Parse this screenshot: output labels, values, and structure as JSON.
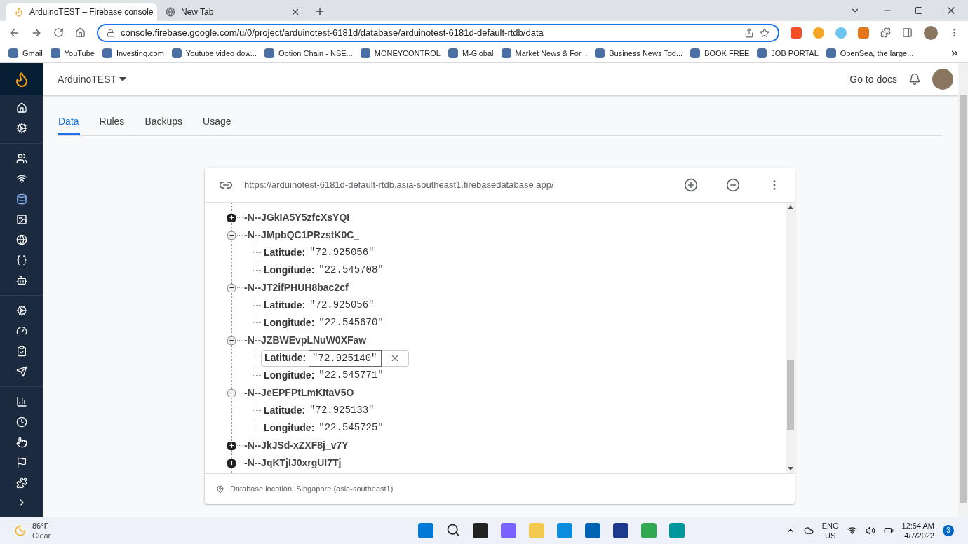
{
  "browser": {
    "tabs": [
      {
        "title": "ArduinoTEST – Firebase console",
        "selected": true
      },
      {
        "title": "New Tab",
        "selected": false
      }
    ],
    "address": "console.firebase.google.com/u/0/project/arduinotest-6181d/database/arduinotest-6181d-default-rtdb/data",
    "bookmarks": [
      "Gmail",
      "YouTube",
      "Investing.com",
      "Youtube video dow...",
      "Option Chain - NSE...",
      "MONEYCONTROL",
      "M-Global",
      "Market News & For...",
      "Business News Tod...",
      "BOOK FREE",
      "JOB PORTAL",
      "OpenSea, the large..."
    ]
  },
  "header": {
    "project": "ArduinoTEST",
    "docs_link": "Go to docs"
  },
  "tabs": [
    {
      "label": "Data",
      "selected": true
    },
    {
      "label": "Rules",
      "selected": false
    },
    {
      "label": "Backups",
      "selected": false
    },
    {
      "label": "Usage",
      "selected": false
    }
  ],
  "database": {
    "url": "https://arduinotest-6181d-default-rtdb.asia-southeast1.firebasedatabase.app/",
    "nodes": [
      {
        "key": "-N--JGkIA5Y5zfcXsYQI",
        "expanded": false
      },
      {
        "key": "-N--JMpbQC1PRzstK0C_",
        "expanded": true,
        "children": [
          {
            "key": "Latitude:",
            "value": "\"72.925056\"",
            "editing": false
          },
          {
            "key": "Longitude:",
            "value": "\"22.545708\"",
            "editing": false
          }
        ]
      },
      {
        "key": "-N--JT2ifPHUH8bac2cf",
        "expanded": true,
        "children": [
          {
            "key": "Latitude:",
            "value": "\"72.925056\"",
            "editing": false
          },
          {
            "key": "Longitude:",
            "value": "\"22.545670\"",
            "editing": false
          }
        ]
      },
      {
        "key": "-N--JZBWEvpLNuW0XFaw",
        "expanded": true,
        "children": [
          {
            "key": "Latitude:",
            "value": "\"72.925140\"",
            "editing": true
          },
          {
            "key": "Longitude:",
            "value": "\"22.545771\"",
            "editing": false
          }
        ]
      },
      {
        "key": "-N--JeEPFPtLmKItaV5O",
        "expanded": true,
        "children": [
          {
            "key": "Latitude:",
            "value": "\"72.925133\"",
            "editing": false
          },
          {
            "key": "Longitude:",
            "value": "\"22.545725\"",
            "editing": false
          }
        ]
      },
      {
        "key": "-N--JkJSd-xZXF8j_v7Y",
        "expanded": false
      },
      {
        "key": "-N--JqKTjIJ0xrgUI7Tj",
        "expanded": false
      }
    ],
    "location": "Database location: Singapore (asia-southeast1)"
  },
  "taskbar": {
    "temperature": "86°F",
    "condition": "Clear",
    "language": "ENG",
    "region": "US",
    "time": "12:54 AM",
    "date": "4/7/2022",
    "notifications": "3"
  }
}
